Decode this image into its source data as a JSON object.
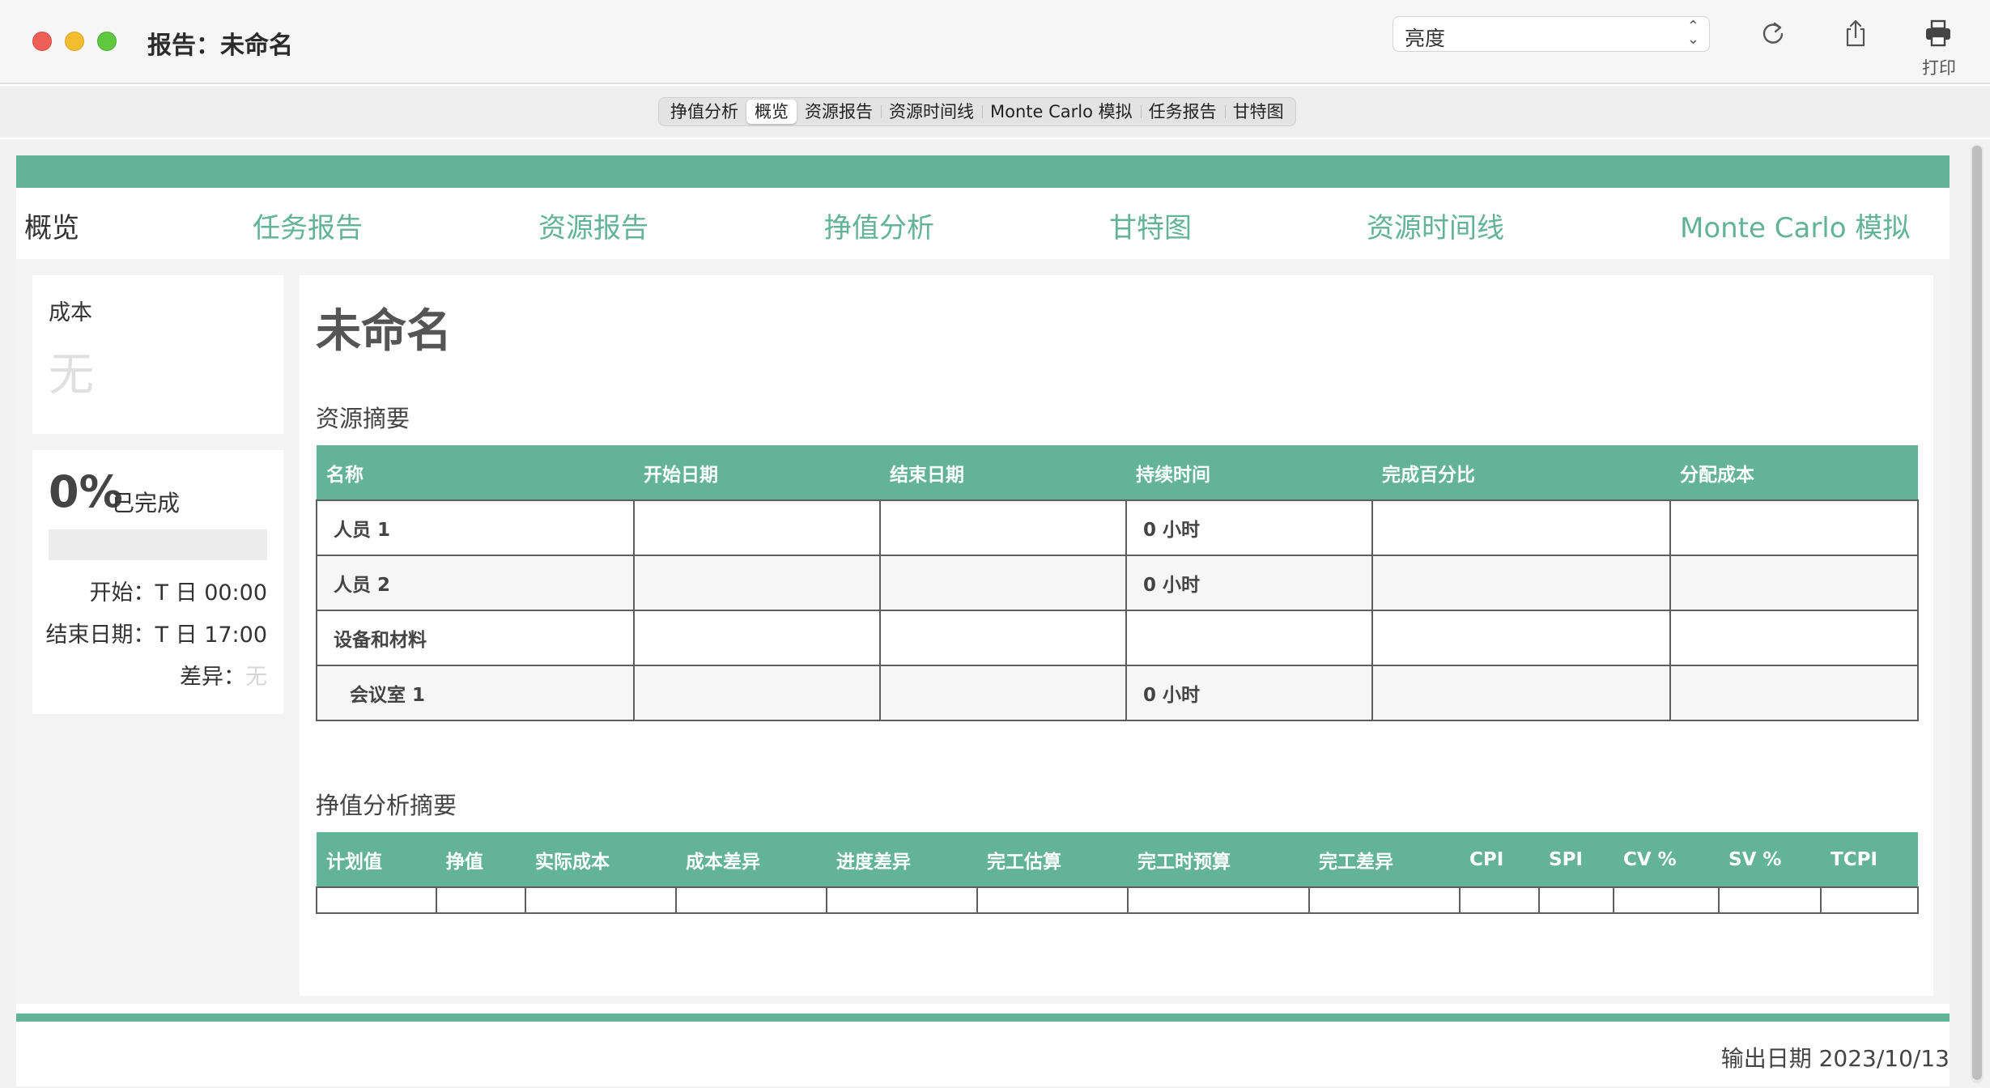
{
  "window": {
    "title": "报告：未命名",
    "theme_select": "亮度",
    "print_label": "打印"
  },
  "segments": [
    "挣值分析",
    "概览",
    "资源报告",
    "资源时间线",
    "Monte Carlo 模拟",
    "任务报告",
    "甘特图"
  ],
  "segments_active_index": 1,
  "nav": {
    "overview": "概览",
    "task_report": "任务报告",
    "resource_report": "资源报告",
    "earned_value": "挣值分析",
    "gantt": "甘特图",
    "resource_timeline": "资源时间线",
    "monte_carlo": "Monte Carlo 模拟"
  },
  "cost_card": {
    "label": "成本",
    "value": "无"
  },
  "progress_card": {
    "percent": "0%",
    "percent_label": "已完成",
    "progress_fraction": 0,
    "start_label": "开始：",
    "start_value": "T 日 00:00",
    "end_label": "结束日期：",
    "end_value": "T 日 17:00",
    "variance_label": "差异：",
    "variance_value": "无"
  },
  "project": {
    "name": "未命名"
  },
  "resource_summary": {
    "title": "资源摘要",
    "columns": [
      "名称",
      "开始日期",
      "结束日期",
      "持续时间",
      "完成百分比",
      "分配成本"
    ],
    "rows": [
      {
        "name": "人员 1",
        "start": "",
        "end": "",
        "duration": "0 小时",
        "percent": "",
        "cost": ""
      },
      {
        "name": "人员 2",
        "start": "",
        "end": "",
        "duration": "0 小时",
        "percent": "",
        "cost": ""
      },
      {
        "name": "设备和材料",
        "start": "",
        "end": "",
        "duration": "",
        "percent": "",
        "cost": ""
      },
      {
        "name": "会议室 1",
        "start": "",
        "end": "",
        "duration": "0 小时",
        "percent": "",
        "cost": ""
      }
    ]
  },
  "ev_summary": {
    "title": "挣值分析摘要",
    "columns": [
      "计划值",
      "挣值",
      "实际成本",
      "成本差异",
      "进度差异",
      "完工估算",
      "完工时预算",
      "完工差异",
      "CPI",
      "SPI",
      "CV %",
      "SV %",
      "TCPI"
    ]
  },
  "footer": {
    "export_date": "输出日期 2023/10/13"
  },
  "colors": {
    "accent": "#62b398"
  }
}
